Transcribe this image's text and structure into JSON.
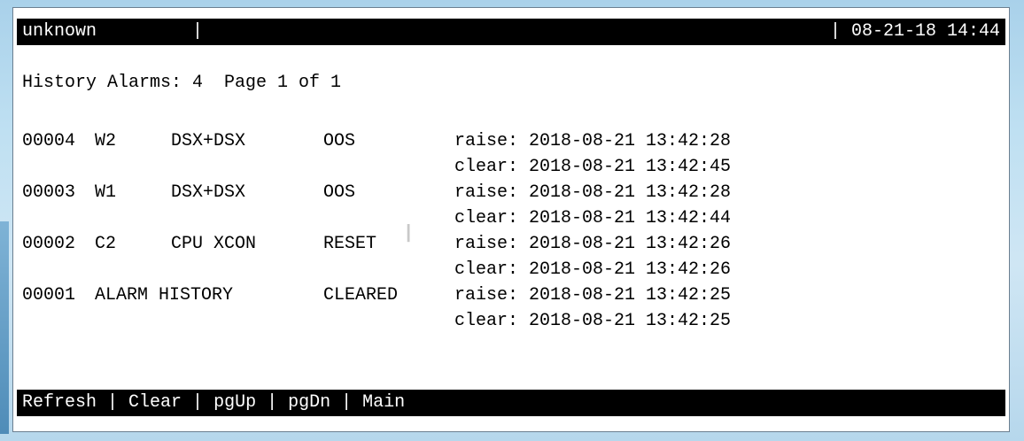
{
  "status_bar": {
    "left_text": "unknown         |",
    "right_text": "| 08-21-18 14:44"
  },
  "summary": "History Alarms: 4  Page 1 of 1",
  "alarms": [
    {
      "id": "00004",
      "channel": "W2",
      "type": "DSX+DSX",
      "state": "OOS",
      "raise": "raise: 2018-08-21 13:42:28",
      "clear": "clear: 2018-08-21 13:42:45"
    },
    {
      "id": "00003",
      "channel": "W1",
      "type": "DSX+DSX",
      "state": "OOS",
      "raise": "raise: 2018-08-21 13:42:28",
      "clear": "clear: 2018-08-21 13:42:44"
    },
    {
      "id": "00002",
      "channel": "C2",
      "type": "CPU XCON",
      "state": "RESET",
      "raise": "raise: 2018-08-21 13:42:26",
      "clear": "clear: 2018-08-21 13:42:26"
    },
    {
      "id": "00001",
      "channel": "ALARM HISTORY",
      "type": "",
      "state": "CLEARED",
      "raise": "raise: 2018-08-21 13:42:25",
      "clear": "clear: 2018-08-21 13:42:25"
    }
  ],
  "menu": {
    "refresh": "Refresh",
    "clear": "Clear",
    "pgup": "pgUp",
    "pgdn": "pgDn",
    "main": "Main",
    "separator": " | "
  },
  "cursor_glyph": "I"
}
